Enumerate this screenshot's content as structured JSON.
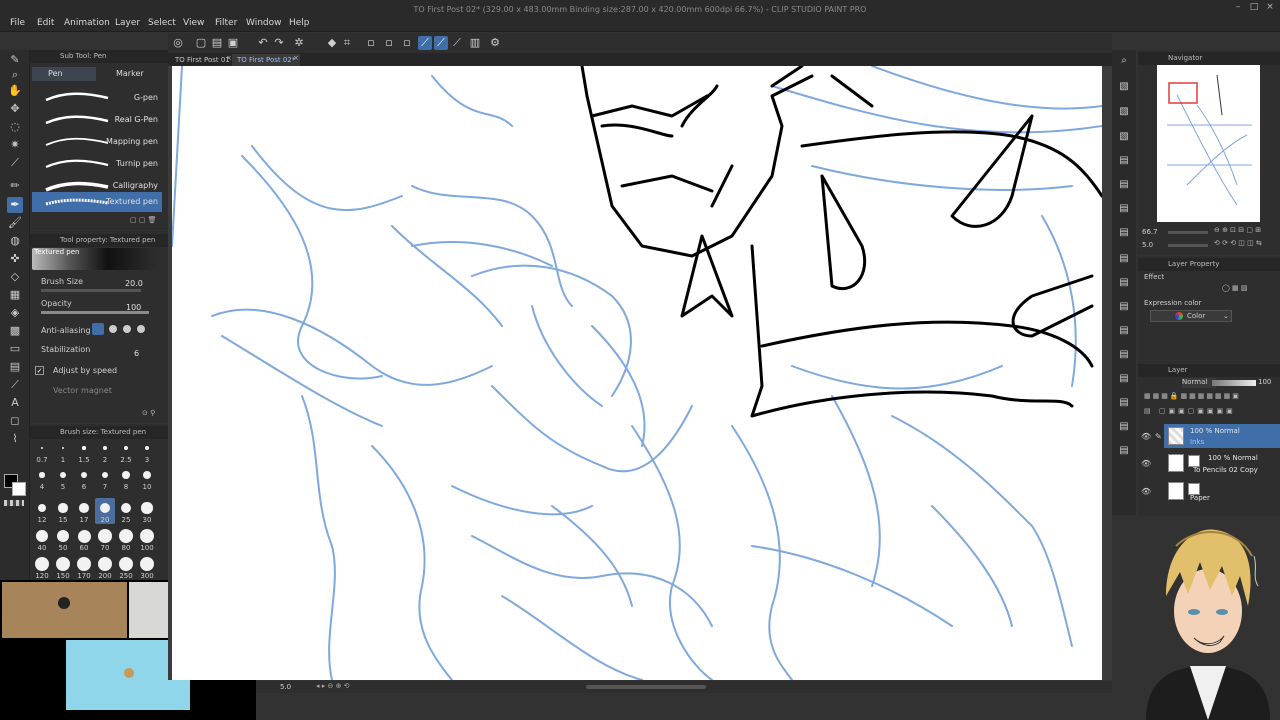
{
  "window": {
    "title": "TO First Post 02* (329.00 x 483.00mm Binding size:287.00 x 420.00mm 600dpi 66.7%) - CLIP STUDIO PAINT PRO"
  },
  "menu": [
    "File",
    "Edit",
    "Animation",
    "Layer",
    "Select",
    "View",
    "Filter",
    "Window",
    "Help"
  ],
  "canvas_tabs": [
    {
      "label": "TO First Post 01"
    },
    {
      "label": "TO First Post 02*"
    }
  ],
  "sub_tool": {
    "header": "Sub Tool: Pen",
    "tabs": [
      "Pen",
      "Marker"
    ],
    "brushes": [
      "G-pen",
      "Real G-Pen",
      "Mapping pen",
      "Turnip pen",
      "Calligraphy",
      "Textured pen"
    ],
    "selected_brush": "Textured pen"
  },
  "tool_property": {
    "header": "Tool property: Textured pen",
    "preset_name": "Textured pen",
    "brush_size_label": "Brush Size",
    "brush_size_value": "20.0",
    "opacity_label": "Opacity",
    "opacity_value": "100",
    "antialiasing_label": "Anti-aliasing",
    "stabilization_label": "Stabilization",
    "stabilization_value": "6",
    "adjust_by_speed_label": "Adjust by speed",
    "vector_magnet_label": "Vector magnet"
  },
  "brush_size_panel": {
    "header": "Brush size: Textured pen",
    "sizes": [
      "0.7",
      "1",
      "1.5",
      "2",
      "2.5",
      "3",
      "4",
      "5",
      "6",
      "7",
      "8",
      "10",
      "12",
      "15",
      "17",
      "20",
      "25",
      "30",
      "40",
      "50",
      "60",
      "70",
      "80",
      "100",
      "120",
      "150",
      "170",
      "200",
      "250",
      "300"
    ],
    "selected": "20"
  },
  "navigator": {
    "header": "Navigator",
    "zoom": "66.7",
    "rotation": "5.0"
  },
  "layer_property": {
    "header": "Layer Property",
    "effect_label": "Effect",
    "expression_color_label": "Expression color",
    "expression_color_value": "Color"
  },
  "layer_panel": {
    "header": "Layer",
    "blend_mode": "Normal",
    "opacity": "100",
    "layers": [
      {
        "mode": "100 % Normal",
        "name": "Inks"
      },
      {
        "mode": "100 % Normal",
        "name": "To Pencils 02 Copy"
      },
      {
        "mode": "",
        "name": "Paper"
      }
    ]
  },
  "status": {
    "zoom_readout": "5.0"
  },
  "colors": {
    "accent": "#3f6ea9",
    "sketch_blue": "#7fa8dc",
    "cam_tan": "#a8845a",
    "cam_grey": "#d8d8d4",
    "cam_cyan": "#8fd6ea"
  }
}
